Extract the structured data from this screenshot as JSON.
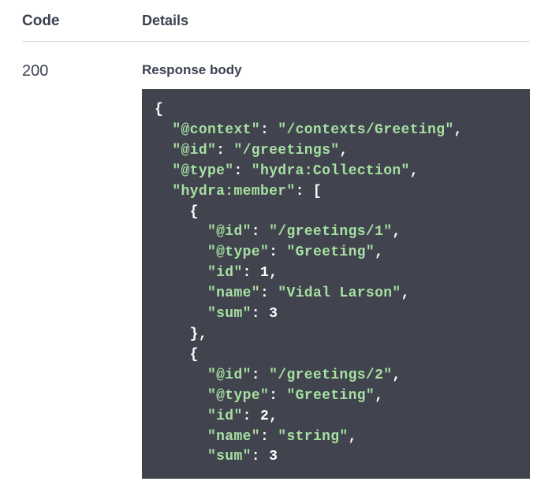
{
  "headers": {
    "code": "Code",
    "details": "Details"
  },
  "response": {
    "status_code": "200",
    "body_label": "Response body",
    "json_body": {
      "@context": "/contexts/Greeting",
      "@id": "/greetings",
      "@type": "hydra:Collection",
      "hydra:member": [
        {
          "@id": "/greetings/1",
          "@type": "Greeting",
          "id": 1,
          "name": "Vidal Larson",
          "sum": 3
        },
        {
          "@id": "/greetings/2",
          "@type": "Greeting",
          "id": 2,
          "name": "string",
          "sum": 3
        }
      ]
    }
  }
}
